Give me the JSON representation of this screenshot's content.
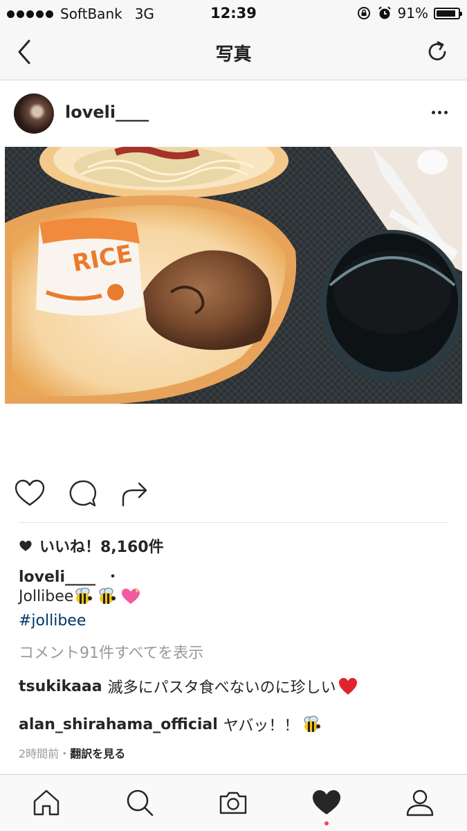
{
  "status_bar": {
    "carrier": "SoftBank",
    "network": "3G",
    "time": "12:39",
    "battery": "91%",
    "battery_level": 0.91
  },
  "nav": {
    "title": "写真"
  },
  "post": {
    "username": "loveli____",
    "likes": "いいね！8,160件",
    "caption_user": "loveli____",
    "caption_separator": "・",
    "caption_text": "Jollibee",
    "hashtag": "#jollibee",
    "view_comments": "コメント91件すべてを表示",
    "comments": [
      {
        "user": "tsukikaaa",
        "text": "滅多にパスタ食べないのに珍しい"
      },
      {
        "user": "alan_shirahama_official",
        "text": "ヤバッ！！"
      }
    ],
    "time_ago": "2時間前",
    "meta_separator": "・",
    "translate": "翻訳を見る"
  },
  "icons": {
    "back": "chevron-left-icon",
    "refresh": "refresh-icon",
    "more": "more-horizontal-icon",
    "like": "heart-outline-icon",
    "comment": "comment-bubble-icon",
    "share": "share-arrow-icon",
    "tabs": [
      "home-icon",
      "search-icon",
      "camera-icon",
      "heart-filled-icon",
      "profile-icon"
    ]
  },
  "colors": {
    "hashtag": "#003569",
    "muted": "#9a9a9a",
    "notification_dot": "#ed4956"
  }
}
